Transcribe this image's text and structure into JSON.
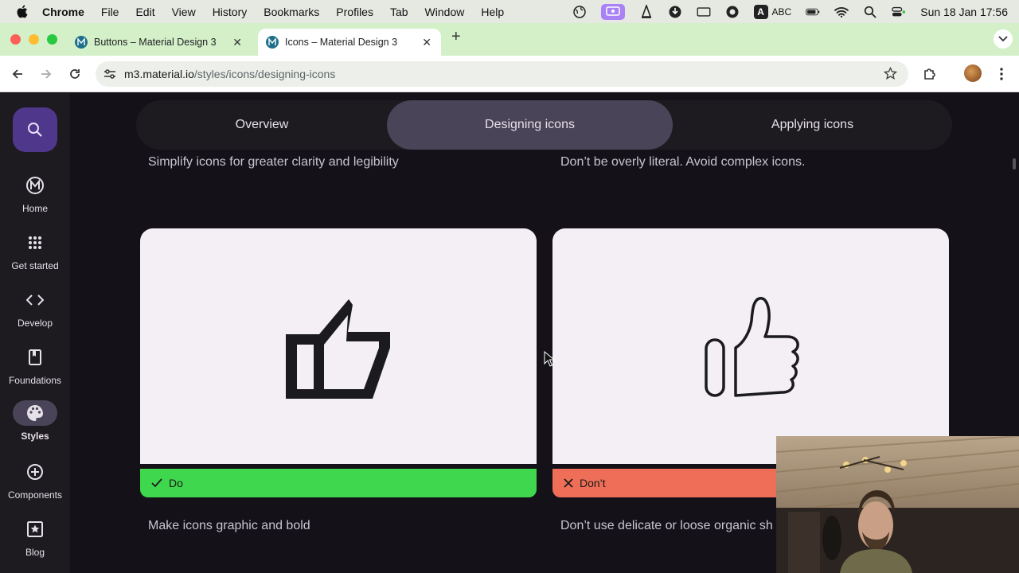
{
  "menubar": {
    "app": "Chrome",
    "items": [
      "File",
      "Edit",
      "View",
      "History",
      "Bookmarks",
      "Profiles",
      "Tab",
      "Window",
      "Help"
    ],
    "input_source": "ABC",
    "clock": "Sun 18 Jan  17:56"
  },
  "browser": {
    "tabs": [
      {
        "title": "Buttons – Material Design 3",
        "active": false
      },
      {
        "title": "Icons – Material Design 3",
        "active": true
      }
    ],
    "url_host": "m3.material.io",
    "url_path": "/styles/icons/designing-icons"
  },
  "rail": {
    "items": [
      {
        "label": "Home",
        "icon": "m3-logo-icon"
      },
      {
        "label": "Get started",
        "icon": "apps-grid-icon"
      },
      {
        "label": "Develop",
        "icon": "code-icon"
      },
      {
        "label": "Foundations",
        "icon": "book-icon"
      },
      {
        "label": "Styles",
        "icon": "palette-icon",
        "active": true
      },
      {
        "label": "Components",
        "icon": "add-circle-icon"
      },
      {
        "label": "Blog",
        "icon": "star-doc-icon"
      }
    ]
  },
  "page_tabs": {
    "items": [
      "Overview",
      "Designing icons",
      "Applying icons"
    ],
    "selected": "Designing icons"
  },
  "content": {
    "top_left_caption": "Simplify icons for greater clarity and legibility",
    "top_right_caption": "Don’t be overly literal. Avoid complex icons.",
    "do_label": "Do",
    "dont_label": "Don’t",
    "bottom_left_caption": "Make icons graphic and bold",
    "bottom_right_caption": "Don’t use delicate or loose organic sh"
  },
  "colors": {
    "do": "#3fd74e",
    "dont": "#ef6e58",
    "accent": "#4f378b",
    "selected_tab": "#4a4458"
  }
}
